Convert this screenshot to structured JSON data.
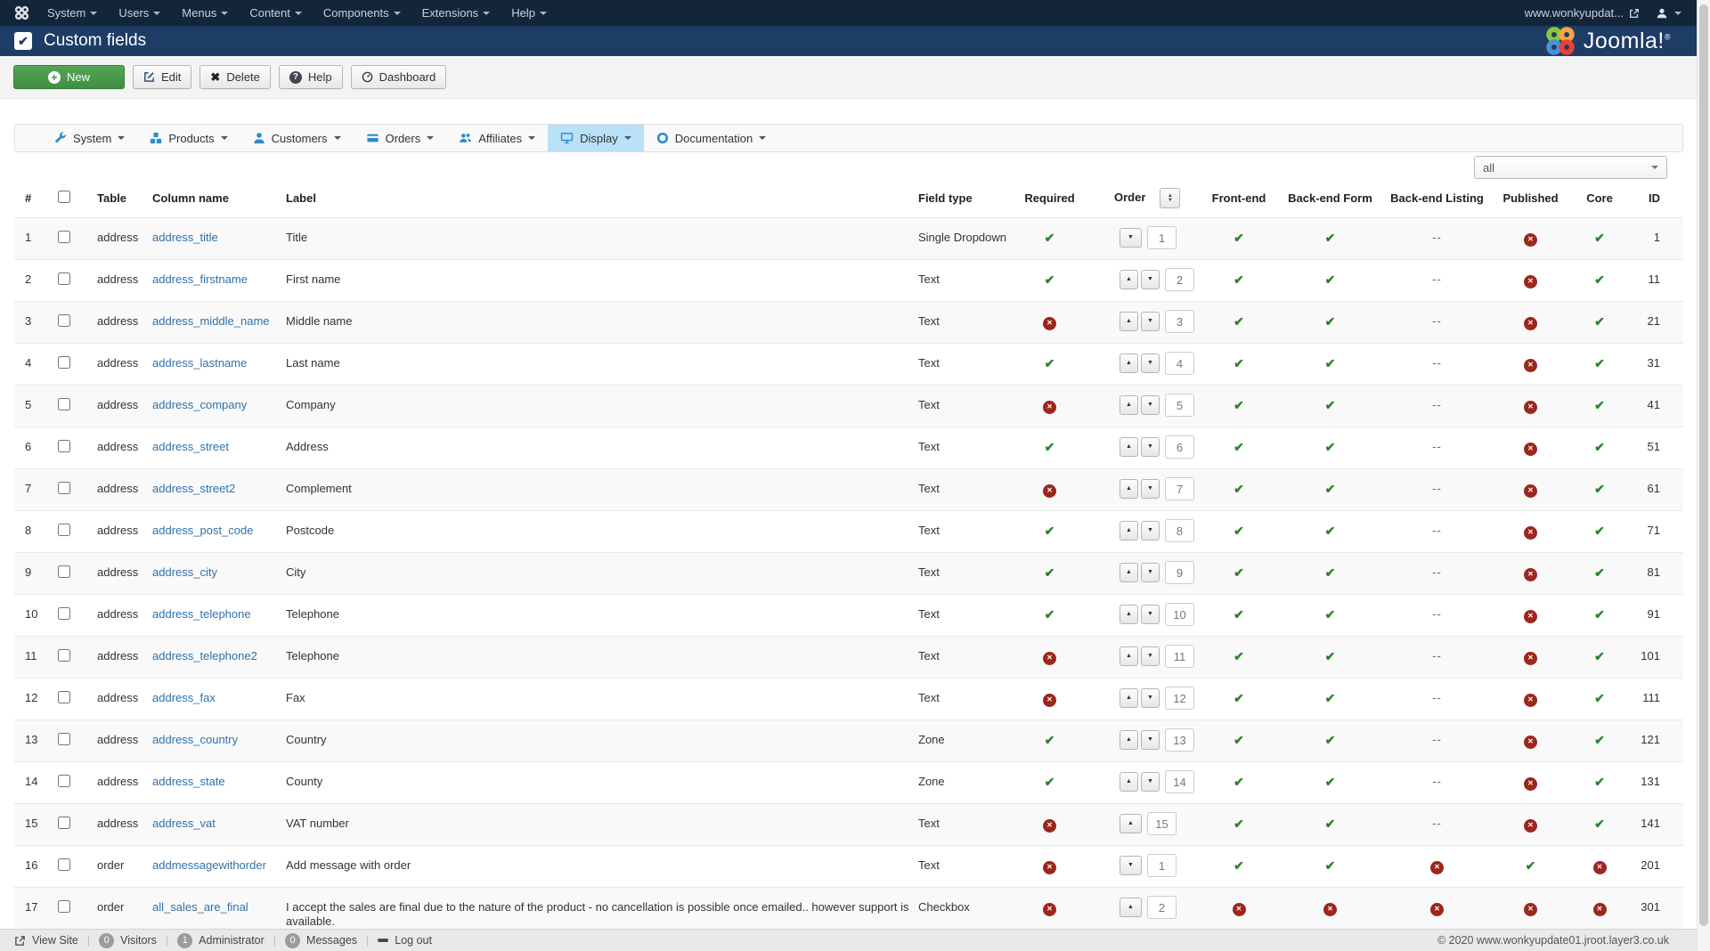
{
  "topbar": {
    "menus": [
      "System",
      "Users",
      "Menus",
      "Content",
      "Components",
      "Extensions",
      "Help"
    ],
    "site_link": "www.wonkyupdat..."
  },
  "header": {
    "title": "Custom fields",
    "brand": "Joomla!",
    "brand_reg": "®"
  },
  "toolbar": {
    "buttons": [
      {
        "label": "New",
        "icon": "plus-circle"
      },
      {
        "label": "Edit",
        "icon": "edit-pencil"
      },
      {
        "label": "Delete",
        "icon": "x-mark"
      },
      {
        "label": "Help",
        "icon": "question-circle"
      },
      {
        "label": "Dashboard",
        "icon": "gauge"
      }
    ]
  },
  "nav": {
    "items": [
      {
        "label": "System",
        "icon": "wrench"
      },
      {
        "label": "Products",
        "icon": "cubes"
      },
      {
        "label": "Customers",
        "icon": "user"
      },
      {
        "label": "Orders",
        "icon": "credit-card"
      },
      {
        "label": "Affiliates",
        "icon": "users"
      },
      {
        "label": "Display",
        "icon": "monitor",
        "active": true
      },
      {
        "label": "Documentation",
        "icon": "life-ring"
      }
    ]
  },
  "filter": {
    "selected": "all"
  },
  "table": {
    "headers": [
      "#",
      "",
      "Table",
      "Column name",
      "Label",
      "Field type",
      "Required",
      "Order",
      "Front-end",
      "Back-end Form",
      "Back-end Listing",
      "Published",
      "Core",
      "ID"
    ],
    "icons": {
      "yes": "✔",
      "no": "✕",
      "dash": "--"
    },
    "rows": [
      {
        "num": "1",
        "table": "address",
        "column_name": "address_title",
        "label": "Title",
        "field_type": "Single Dropdown",
        "required": "yes",
        "order": {
          "up": false,
          "down": true,
          "value": "1"
        },
        "front_end": "yes",
        "back_end_form": "yes",
        "back_end_listing": "dash",
        "published": "no",
        "core": "yes",
        "id": "1"
      },
      {
        "num": "2",
        "table": "address",
        "column_name": "address_firstname",
        "label": "First name",
        "field_type": "Text",
        "required": "yes",
        "order": {
          "up": true,
          "down": true,
          "value": "2"
        },
        "front_end": "yes",
        "back_end_form": "yes",
        "back_end_listing": "dash",
        "published": "no",
        "core": "yes",
        "id": "11"
      },
      {
        "num": "3",
        "table": "address",
        "column_name": "address_middle_name",
        "label": "Middle name",
        "field_type": "Text",
        "required": "no",
        "order": {
          "up": true,
          "down": true,
          "value": "3"
        },
        "front_end": "yes",
        "back_end_form": "yes",
        "back_end_listing": "dash",
        "published": "no",
        "core": "yes",
        "id": "21"
      },
      {
        "num": "4",
        "table": "address",
        "column_name": "address_lastname",
        "label": "Last name",
        "field_type": "Text",
        "required": "yes",
        "order": {
          "up": true,
          "down": true,
          "value": "4"
        },
        "front_end": "yes",
        "back_end_form": "yes",
        "back_end_listing": "dash",
        "published": "no",
        "core": "yes",
        "id": "31"
      },
      {
        "num": "5",
        "table": "address",
        "column_name": "address_company",
        "label": "Company",
        "field_type": "Text",
        "required": "no",
        "order": {
          "up": true,
          "down": true,
          "value": "5"
        },
        "front_end": "yes",
        "back_end_form": "yes",
        "back_end_listing": "dash",
        "published": "no",
        "core": "yes",
        "id": "41"
      },
      {
        "num": "6",
        "table": "address",
        "column_name": "address_street",
        "label": "Address",
        "field_type": "Text",
        "required": "yes",
        "order": {
          "up": true,
          "down": true,
          "value": "6"
        },
        "front_end": "yes",
        "back_end_form": "yes",
        "back_end_listing": "dash",
        "published": "no",
        "core": "yes",
        "id": "51"
      },
      {
        "num": "7",
        "table": "address",
        "column_name": "address_street2",
        "label": "Complement",
        "field_type": "Text",
        "required": "no",
        "order": {
          "up": true,
          "down": true,
          "value": "7"
        },
        "front_end": "yes",
        "back_end_form": "yes",
        "back_end_listing": "dash",
        "published": "no",
        "core": "yes",
        "id": "61"
      },
      {
        "num": "8",
        "table": "address",
        "column_name": "address_post_code",
        "label": "Postcode",
        "field_type": "Text",
        "required": "yes",
        "order": {
          "up": true,
          "down": true,
          "value": "8"
        },
        "front_end": "yes",
        "back_end_form": "yes",
        "back_end_listing": "dash",
        "published": "no",
        "core": "yes",
        "id": "71"
      },
      {
        "num": "9",
        "table": "address",
        "column_name": "address_city",
        "label": "City",
        "field_type": "Text",
        "required": "yes",
        "order": {
          "up": true,
          "down": true,
          "value": "9"
        },
        "front_end": "yes",
        "back_end_form": "yes",
        "back_end_listing": "dash",
        "published": "no",
        "core": "yes",
        "id": "81"
      },
      {
        "num": "10",
        "table": "address",
        "column_name": "address_telephone",
        "label": "Telephone",
        "field_type": "Text",
        "required": "yes",
        "order": {
          "up": true,
          "down": true,
          "value": "10"
        },
        "front_end": "yes",
        "back_end_form": "yes",
        "back_end_listing": "dash",
        "published": "no",
        "core": "yes",
        "id": "91"
      },
      {
        "num": "11",
        "table": "address",
        "column_name": "address_telephone2",
        "label": "Telephone",
        "field_type": "Text",
        "required": "no",
        "order": {
          "up": true,
          "down": true,
          "value": "11"
        },
        "front_end": "yes",
        "back_end_form": "yes",
        "back_end_listing": "dash",
        "published": "no",
        "core": "yes",
        "id": "101"
      },
      {
        "num": "12",
        "table": "address",
        "column_name": "address_fax",
        "label": "Fax",
        "field_type": "Text",
        "required": "no",
        "order": {
          "up": true,
          "down": true,
          "value": "12"
        },
        "front_end": "yes",
        "back_end_form": "yes",
        "back_end_listing": "dash",
        "published": "no",
        "core": "yes",
        "id": "111"
      },
      {
        "num": "13",
        "table": "address",
        "column_name": "address_country",
        "label": "Country",
        "field_type": "Zone",
        "required": "yes",
        "order": {
          "up": true,
          "down": true,
          "value": "13"
        },
        "front_end": "yes",
        "back_end_form": "yes",
        "back_end_listing": "dash",
        "published": "no",
        "core": "yes",
        "id": "121"
      },
      {
        "num": "14",
        "table": "address",
        "column_name": "address_state",
        "label": "County",
        "field_type": "Zone",
        "required": "yes",
        "order": {
          "up": true,
          "down": true,
          "value": "14"
        },
        "front_end": "yes",
        "back_end_form": "yes",
        "back_end_listing": "dash",
        "published": "no",
        "core": "yes",
        "id": "131"
      },
      {
        "num": "15",
        "table": "address",
        "column_name": "address_vat",
        "label": "VAT number",
        "field_type": "Text",
        "required": "no",
        "order": {
          "up": true,
          "down": false,
          "value": "15"
        },
        "front_end": "yes",
        "back_end_form": "yes",
        "back_end_listing": "dash",
        "published": "no",
        "core": "yes",
        "id": "141"
      },
      {
        "num": "16",
        "table": "order",
        "column_name": "addmessagewithorder",
        "label": "Add message with order",
        "field_type": "Text",
        "required": "no",
        "order": {
          "up": false,
          "down": true,
          "value": "1"
        },
        "front_end": "yes",
        "back_end_form": "yes",
        "back_end_listing": "no",
        "published": "yes",
        "core": "no",
        "id": "201"
      },
      {
        "num": "17",
        "table": "order",
        "column_name": "all_sales_are_final",
        "label": "I accept the sales are final due to the nature of the product - no cancellation is possible once emailed.. however support is available.",
        "field_type": "Checkbox",
        "required": "no",
        "order": {
          "up": true,
          "down": false,
          "value": "2"
        },
        "front_end": "no",
        "back_end_form": "no",
        "back_end_listing": "no",
        "published": "no",
        "core": "no",
        "id": "301"
      }
    ]
  },
  "footer": {
    "view_site": "View Site",
    "visitors": {
      "count": "0",
      "label": "Visitors"
    },
    "admins": {
      "count": "1",
      "label": "Administrator"
    },
    "messages": {
      "count": "0",
      "label": "Messages"
    },
    "logout": "Log out",
    "copyright": "© 2020 www.wonkyupdate01.jroot.layer3.co.uk"
  },
  "colors": {
    "topbar_bg": "#132639",
    "header_bg": "#1d3c66",
    "link": "#3071a9",
    "success": "#2c842c",
    "danger": "#9d261d",
    "active_tab": "#b9e1f8",
    "new_button": "#418f41"
  }
}
